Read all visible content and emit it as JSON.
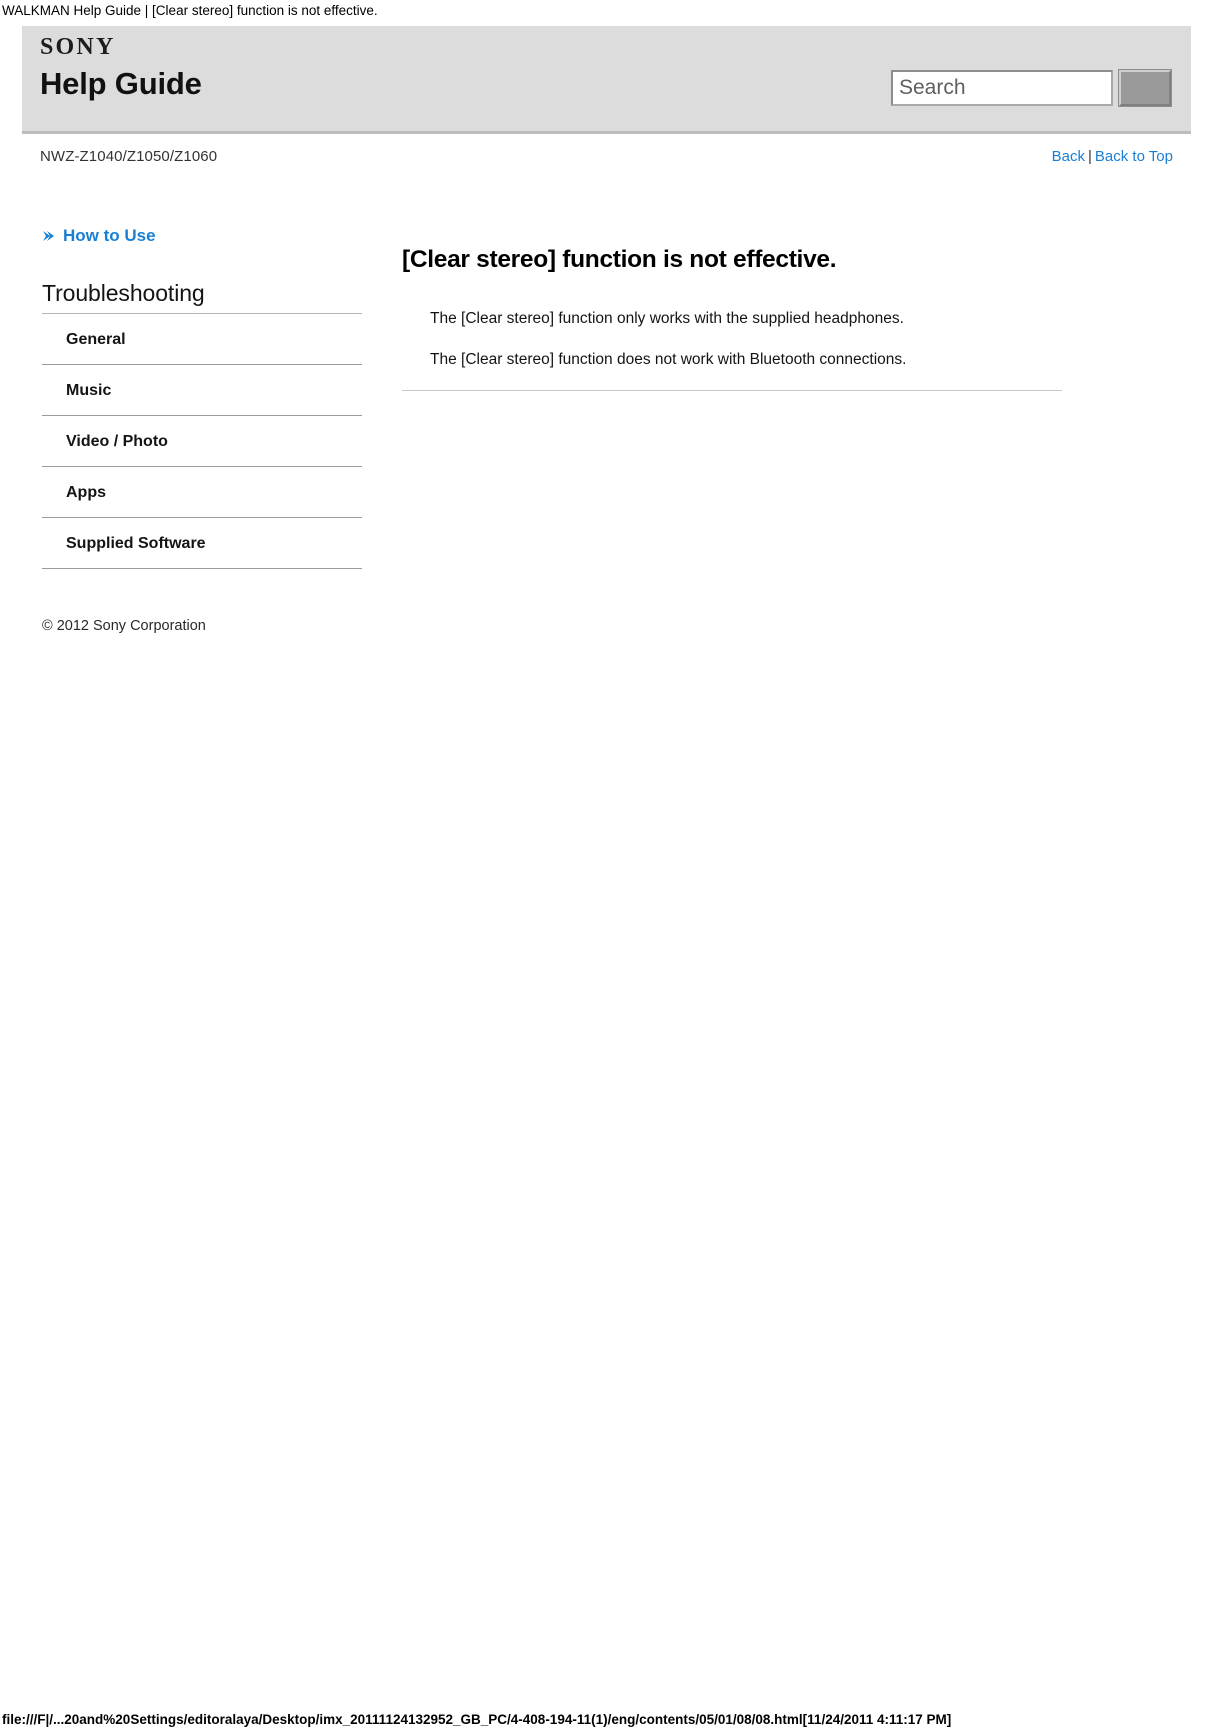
{
  "print_header": "WALKMAN Help Guide | [Clear stereo] function is not effective.",
  "header": {
    "brand": "SONY",
    "title": "Help Guide",
    "search": {
      "placeholder": "Search",
      "value": "",
      "button_icon": "search-submit-icon"
    }
  },
  "subbar": {
    "model": "NWZ-Z1040/Z1050/Z1060",
    "back_label": "Back",
    "separator": "|",
    "back_to_top_label": "Back to Top"
  },
  "sidebar": {
    "how_to_use": {
      "icon": "chevron-right-icon",
      "label": "How to Use"
    },
    "section_title": "Troubleshooting",
    "items": [
      {
        "label": "General"
      },
      {
        "label": "Music"
      },
      {
        "label": "Video / Photo"
      },
      {
        "label": "Apps"
      },
      {
        "label": "Supplied Software"
      }
    ],
    "copyright": "© 2012 Sony Corporation"
  },
  "main": {
    "heading": "[Clear stereo] function is not effective.",
    "paragraphs": [
      "The [Clear stereo] function only works with the supplied headphones.",
      "The [Clear stereo] function does not work with Bluetooth connections."
    ]
  },
  "print_footer": "file:///F|/...20and%20Settings/editoralaya/Desktop/imx_20111124132952_GB_PC/4-408-194-11(1)/eng/contents/05/01/08/08.html[11/24/2011 4:11:17 PM]",
  "colors": {
    "link": "#1a7fd4",
    "header_band": "#dcdcdc",
    "rule": "#9b9b9b"
  }
}
